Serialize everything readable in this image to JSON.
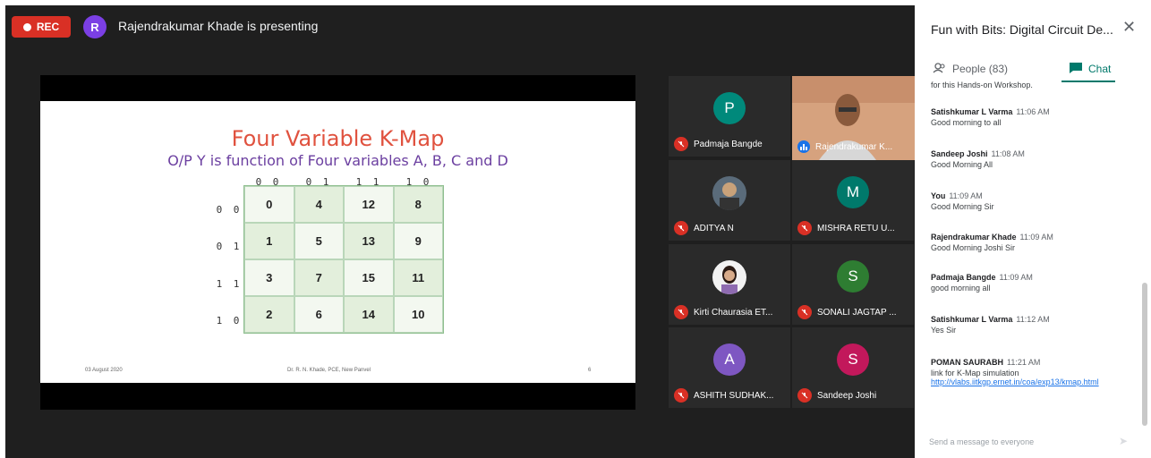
{
  "recording": {
    "label": "REC"
  },
  "presenter": {
    "initial": "R",
    "text": "Rajendrakumar Khade is presenting"
  },
  "slide": {
    "title": "Four Variable K-Map",
    "subtitle": "O/P Y is function of Four variables A, B, C and D",
    "col_headers": [
      "0 0",
      "0 1",
      "1 1",
      "1 0"
    ],
    "row_headers": [
      "0 0",
      "0 1",
      "1 1",
      "1 0"
    ],
    "cells": [
      [
        "0",
        "4",
        "12",
        "8"
      ],
      [
        "1",
        "5",
        "13",
        "9"
      ],
      [
        "3",
        "7",
        "15",
        "11"
      ],
      [
        "2",
        "6",
        "14",
        "10"
      ]
    ],
    "footer_left": "03 August 2020",
    "footer_center": "Dr. R. N. Khade, PCE, New Panvel",
    "footer_right": "6"
  },
  "participants": [
    {
      "name": "Padmaja Bangde",
      "initial": "P",
      "color": "#00897b",
      "type": "avatar"
    },
    {
      "name": "Rajendrakumar K...",
      "type": "video"
    },
    {
      "name": "ADITYA N",
      "type": "photo"
    },
    {
      "name": "MISHRA RETU U...",
      "initial": "M",
      "color": "#00796b",
      "type": "avatar"
    },
    {
      "name": "Kirti Chaurasia ET...",
      "type": "photo"
    },
    {
      "name": "SONALI JAGTAP ...",
      "initial": "S",
      "color": "#2e7d32",
      "type": "avatar"
    },
    {
      "name": "ASHITH SUDHAK...",
      "initial": "A",
      "color": "#7e57c2",
      "type": "avatar"
    },
    {
      "name": "Sandeep Joshi",
      "initial": "S",
      "color": "#c2185b",
      "type": "avatar"
    }
  ],
  "panel": {
    "title": "Fun with Bits: Digital Circuit De...",
    "people_tab": "People (83)",
    "chat_tab": "Chat",
    "partial_text": "for this Hands-on Workshop.",
    "messages": [
      {
        "sender": "Satishkumar L Varma",
        "time": "11:06 AM",
        "text": "Good morning to all"
      },
      {
        "sender": "Sandeep Joshi",
        "time": "11:08 AM",
        "text": "Good Morning All"
      },
      {
        "sender": "You",
        "time": "11:09 AM",
        "text": "Good Morning Sir"
      },
      {
        "sender": "Rajendrakumar Khade",
        "time": "11:09 AM",
        "text": "Good Morning Joshi Sir"
      },
      {
        "sender": "Padmaja Bangde",
        "time": "11:09 AM",
        "text": "good morning  all"
      },
      {
        "sender": "Satishkumar L Varma",
        "time": "11:12 AM",
        "text": "Yes Sir"
      },
      {
        "sender": "POMAN SAURABH",
        "time": "11:21 AM",
        "text": "link for K-Map simulation",
        "link": "http://vlabs.iitkgp.ernet.in/coa/exp13/kmap.html"
      }
    ],
    "compose_placeholder": "Send a message to everyone"
  }
}
